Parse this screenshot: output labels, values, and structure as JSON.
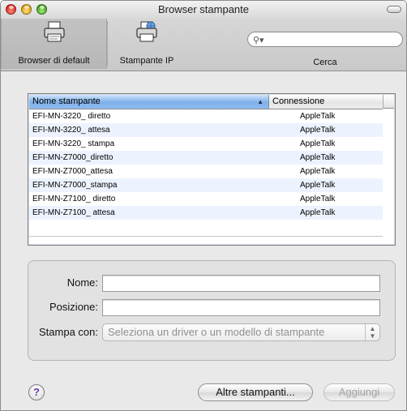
{
  "window": {
    "title": "Browser stampante"
  },
  "toolbar": {
    "items": [
      {
        "label": "Browser di default",
        "icon": "printer-icon"
      },
      {
        "label": "Stampante IP",
        "icon": "network-printer-icon"
      }
    ],
    "search": {
      "label": "Cerca",
      "placeholder": "",
      "value": ""
    }
  },
  "printer_list": {
    "columns": [
      "Nome stampante",
      "Connessione"
    ],
    "sort_column": "Nome stampante",
    "rows": [
      {
        "name": "EFI-MN-3220_ diretto",
        "connection": "AppleTalk"
      },
      {
        "name": "EFI-MN-3220_ attesa",
        "connection": "AppleTalk"
      },
      {
        "name": "EFI-MN-3220_ stampa",
        "connection": "AppleTalk"
      },
      {
        "name": "EFI-MN-Z7000_diretto",
        "connection": "AppleTalk"
      },
      {
        "name": "EFI-MN-Z7000_attesa",
        "connection": "AppleTalk"
      },
      {
        "name": "EFI-MN-Z7000_stampa",
        "connection": "AppleTalk"
      },
      {
        "name": "EFI-MN-Z7100_ diretto",
        "connection": "AppleTalk"
      },
      {
        "name": "EFI-MN-Z7100_ attesa",
        "connection": "AppleTalk"
      }
    ]
  },
  "form": {
    "name_label": "Nome:",
    "name_value": "",
    "location_label": "Posizione:",
    "location_value": "",
    "print_with_label": "Stampa con:",
    "print_with_value": "Seleziona un driver o un modello di stampante"
  },
  "buttons": {
    "help": "?",
    "more_printers": "Altre stampanti...",
    "add": "Aggiungi"
  }
}
